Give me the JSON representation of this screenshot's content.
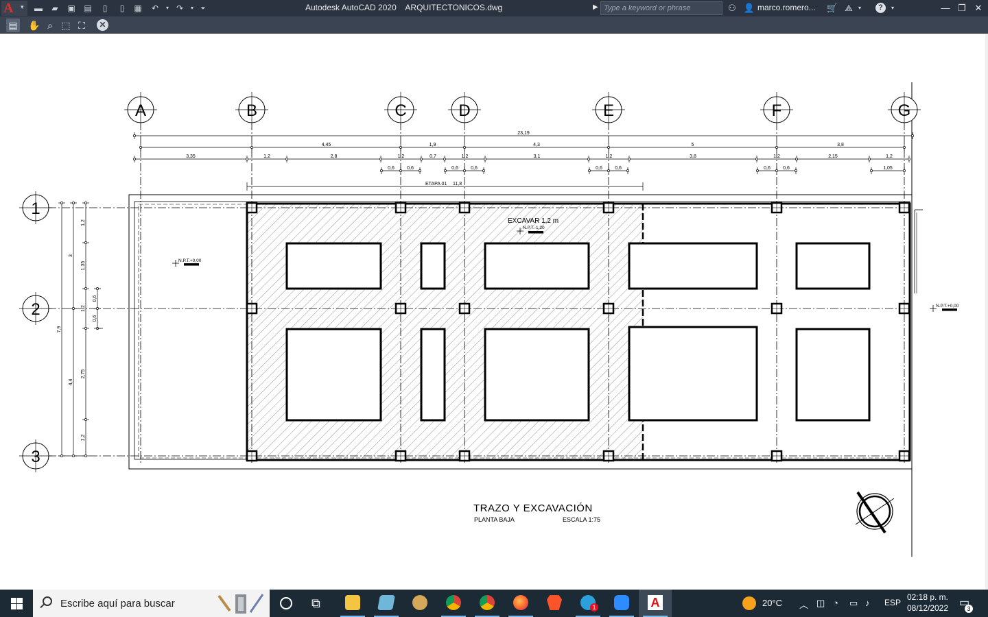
{
  "window": {
    "title": "Autodesk AutoCAD 2020    ARQUITECTONICOS.dwg",
    "search_placeholder": "Type a keyword or phrase",
    "user": "marco.romero...",
    "app_icon": "autocad-logo"
  },
  "toolbar": {
    "tools": [
      "print-icon",
      "pan-icon",
      "zoom-icon",
      "zoom-window-icon",
      "zoom-extents-icon",
      "close-icon"
    ]
  },
  "drawing": {
    "grid_columns": [
      "A",
      "B",
      "C",
      "D",
      "E",
      "F",
      "G"
    ],
    "grid_rows": [
      "1",
      "2",
      "3"
    ],
    "dim_total": "23,19",
    "dims_axes": [
      "4,45",
      "1,9",
      "4,3",
      "5",
      "3,8"
    ],
    "dims_detail": [
      "3,35",
      "1,2",
      "2,8",
      "1,2",
      "0,7",
      "1,2",
      "3,1",
      "1,2",
      "3,8",
      "1,2",
      "2,15",
      "1,2"
    ],
    "dims_half": [
      "0,6",
      "0,6",
      "0,6",
      "0,6",
      "0,6",
      "0,6",
      "0,6",
      "0,6",
      "1,05"
    ],
    "etapa_label": "ETAPA 01",
    "etapa_value": "11,8",
    "vert_total": "7,9",
    "vert_axes": [
      "3",
      "4,4"
    ],
    "vert_detail": [
      "1,2",
      "1,35",
      "1,2",
      "2,75",
      "1,2"
    ],
    "vert_small": [
      "0,6",
      "0,6"
    ],
    "excavar": "EXCAVAR 1,2 m",
    "npt_excavar": "N.P.T.-1,20",
    "npt_left": "N.P.T.+0,00",
    "npt_right": "N.P.T.+0,00",
    "sheet_title": "TRAZO Y EXCAVACIÓN",
    "sheet_subtitle": "PLANTA BAJA",
    "sheet_scale": "ESCALA 1:75"
  },
  "taskbar": {
    "search_text": "Escribe aquí para buscar",
    "weather": "20°C",
    "lang": "ESP",
    "time": "02:18 p. m.",
    "date": "08/12/2022",
    "notifications": "3",
    "telegram_badge": "1",
    "apps": [
      "cortana-icon",
      "task-view-icon",
      "file-explorer-icon",
      "notepad-icon",
      "paint-icon",
      "chrome-icon",
      "chrome-profile-icon",
      "firefox-icon",
      "brave-icon",
      "telegram-icon",
      "zoom-icon",
      "autocad-icon"
    ]
  }
}
